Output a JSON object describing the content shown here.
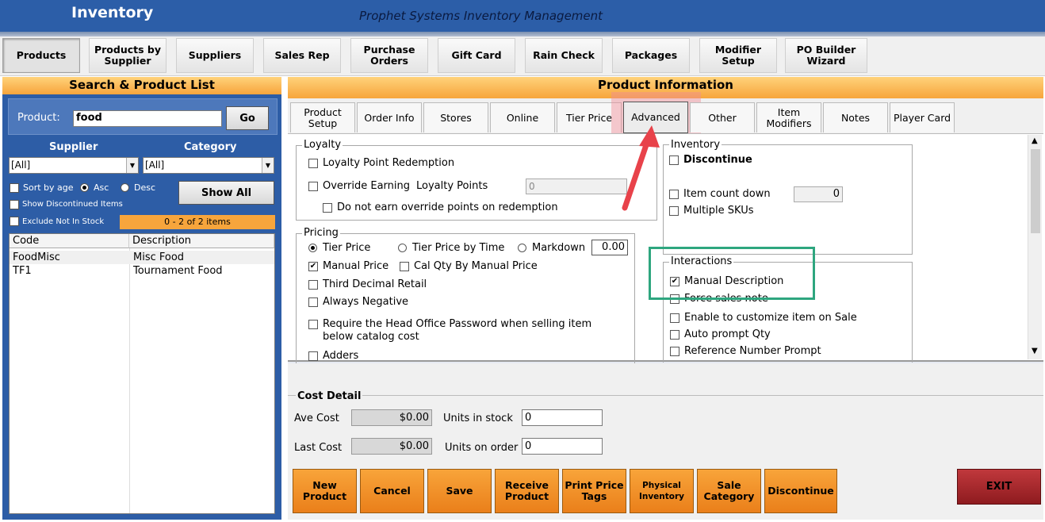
{
  "window": {
    "title": "Inventory",
    "subtitle": "Prophet Systems Inventory Management"
  },
  "main_tabs": [
    {
      "label": "Products",
      "active": true
    },
    {
      "label": "Products by Supplier"
    },
    {
      "label": "Suppliers"
    },
    {
      "label": "Sales Rep"
    },
    {
      "label": "Purchase Orders"
    },
    {
      "label": "Gift Card"
    },
    {
      "label": "Rain Check"
    },
    {
      "label": "Packages"
    },
    {
      "label": "Modifier Setup"
    },
    {
      "label": "PO Builder Wizard"
    }
  ],
  "search": {
    "header": "Search & Product List",
    "product_label": "Product:",
    "product_value": "food",
    "go_label": "Go",
    "supplier_label": "Supplier",
    "category_label": "Category",
    "supplier_value": "[All]",
    "category_value": "[All]",
    "sort_by_age": "Sort by age",
    "asc": "Asc",
    "desc": "Desc",
    "show_all": "Show All",
    "show_discontinued": "Show Discontinued Items",
    "exclude_not_in_stock": "Exclude Not In Stock",
    "item_count": "0 - 2 of 2 items",
    "columns": [
      "Code",
      "Description"
    ],
    "rows": [
      {
        "code": "FoodMisc",
        "description": "Misc Food"
      },
      {
        "code": "TF1",
        "description": "Tournament Food"
      }
    ]
  },
  "product_info": {
    "header": "Product Information",
    "tabs": [
      {
        "label": "Product Setup"
      },
      {
        "label": "Order Info"
      },
      {
        "label": "Stores"
      },
      {
        "label": "Online"
      },
      {
        "label": "Tier Price"
      },
      {
        "label": "Advanced",
        "active": true
      },
      {
        "label": "Other"
      },
      {
        "label": "Item Modifiers"
      },
      {
        "label": "Notes"
      },
      {
        "label": "Player Card"
      }
    ],
    "loyalty": {
      "title": "Loyalty",
      "redemption": "Loyalty Point Redemption",
      "override": "Override Earning",
      "loyalty_points": "Loyalty Points",
      "points_value": "0",
      "no_override_points": "Do not earn override points on redemption"
    },
    "pricing": {
      "title": "Pricing",
      "tier_price": "Tier Price",
      "tier_price_by_time": "Tier Price by Time",
      "markdown": "Markdown",
      "markdown_value": "0.00",
      "manual_price": "Manual Price",
      "cal_qty": "Cal Qty By Manual Price",
      "third_decimal": "Third Decimal Retail",
      "always_negative": "Always Negative",
      "require_password_1": "Require the Head Office Password when selling item",
      "require_password_2": "below catalog cost",
      "adders": "Adders"
    },
    "inventory": {
      "title": "Inventory",
      "discontinue": "Discontinue",
      "item_count_down": "Item count down",
      "item_count_value": "0",
      "multiple_skus": "Multiple SKUs"
    },
    "interactions": {
      "title": "Interactions",
      "manual_description": "Manual Description",
      "force_sales_note": "Force sales note",
      "customize": "Enable to customize item on Sale",
      "auto_prompt": "Auto prompt Qty",
      "reference_prompt": "Reference Number Prompt"
    }
  },
  "cost_detail": {
    "title": "Cost Detail",
    "ave_cost_label": "Ave Cost",
    "ave_cost": "$0.00",
    "last_cost_label": "Last Cost",
    "last_cost": "$0.00",
    "units_in_stock_label": "Units in stock",
    "units_in_stock": "0",
    "units_on_order_label": "Units on order",
    "units_on_order": "0"
  },
  "buttons": {
    "new_product": "New Product",
    "cancel": "Cancel",
    "save": "Save",
    "receive_product": "Receive Product",
    "print_price_tags": "Print Price Tags",
    "physical_inventory": "Physical Inventory",
    "sale_category": "Sale Category",
    "discontinue": "Discontinue",
    "exit": "EXIT"
  },
  "colors": {
    "title_blue": "#2c5ea8",
    "accent_orange": "#f7a53c",
    "annotation_green": "#2ea67f",
    "annotation_arrow": "#e8424a"
  }
}
